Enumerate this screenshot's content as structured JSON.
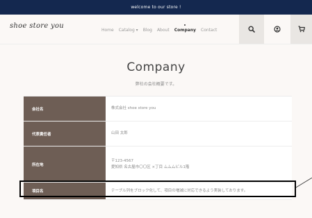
{
  "topbar": {
    "text": "welcome to our store !"
  },
  "header": {
    "logo": "shoe store you",
    "nav": [
      {
        "label": "Home"
      },
      {
        "label": "Catalog ▾"
      },
      {
        "label": "Blog"
      },
      {
        "label": "About"
      },
      {
        "label": "Company",
        "active": true
      },
      {
        "label": "Contact"
      }
    ],
    "icons": {
      "search": "search-icon",
      "account": "account-icon",
      "cart": "cart-icon"
    }
  },
  "page": {
    "title": "Company",
    "subtitle": "弊社の会社概要です。"
  },
  "company_table": [
    {
      "label": "会社名",
      "value_lines": [
        "株式会社 shoe store you"
      ]
    },
    {
      "label": "代表責任者",
      "value_lines": [
        "山田 太郎"
      ]
    },
    {
      "label": "所在地",
      "value_lines": [
        "〒123-4567",
        "愛知県 名古屋市〇〇区 ×丁目 ムムムビル1階"
      ]
    },
    {
      "label": "項目名",
      "value_lines": [
        "テーブル列をブロック化して、項目の増減に対応できるよう実装しております。"
      ]
    }
  ],
  "colors": {
    "topbar_bg": "#14284f",
    "table_header_bg": "#6e5e55",
    "page_bg": "#fbf8f6",
    "highlight_border": "#000000"
  }
}
